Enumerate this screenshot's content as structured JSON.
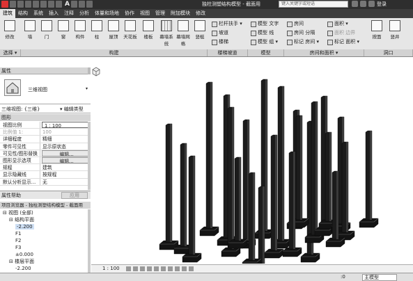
{
  "titlebar": {
    "qat_letter": "A",
    "doc_title": "独柱测塑结构模型 - 截面用",
    "search_placeholder": "键入关键字或短语",
    "login": "登录"
  },
  "tabs": [
    "建筑",
    "结构",
    "系统",
    "插入",
    "注释",
    "分析",
    "体量和场地",
    "协作",
    "视图",
    "管理",
    "附加模块",
    "修改"
  ],
  "ribbon": {
    "modify": "修改",
    "select": "选择 ▾",
    "build_buttons": [
      "墙",
      "门",
      "窗",
      "构件",
      "柱",
      "屋顶",
      "天花板",
      "楼板",
      "幕墙系统",
      "幕墙网格",
      "竖梃"
    ],
    "build_label": "构建",
    "circulation": [
      "栏杆扶手 ▾",
      "坡道",
      "楼梯"
    ],
    "circulation_label": "楼梯坡道",
    "model": [
      "模型 文字",
      "模型 线",
      "模型 组 ▾"
    ],
    "model_label": "模型",
    "room": [
      "房间",
      "房间 分隔",
      "标记 房间 ▾"
    ],
    "area": [
      "面积 ▾",
      "面积 边界",
      "标记 面积 ▾"
    ],
    "room_label": "房间和面积 ▾",
    "opening_buttons": [
      "按面",
      "竖井"
    ],
    "opening_label": "洞口"
  },
  "properties": {
    "header": "属性",
    "type_name": "三维视图",
    "view_select": "三维视图: {三维}",
    "edit_type": "编辑类型",
    "group": "图形",
    "rows": [
      {
        "k": "视图比例",
        "v": "1 : 100"
      },
      {
        "k": "比例值 1:",
        "v": "100"
      },
      {
        "k": "详细程度",
        "v": "精细"
      },
      {
        "k": "零件可见性",
        "v": "显示原状态"
      },
      {
        "k": "可见性/图形替换",
        "v": "编辑..."
      },
      {
        "k": "图形显示选项",
        "v": "编辑..."
      },
      {
        "k": "规程",
        "v": "建筑"
      },
      {
        "k": "显示隐藏线",
        "v": "按规程"
      },
      {
        "k": "默认分析显示...",
        "v": "无"
      }
    ],
    "help": "属性帮助",
    "apply": "应用"
  },
  "browser": {
    "header": "项目浏览器 - 独柱测塑结构模型 - 截面用",
    "nodes": [
      {
        "t": "⊟ 视图 (全部)",
        "lvl": 0
      },
      {
        "t": "⊟ 结构平面",
        "lvl": 1
      },
      {
        "t": "-2.200",
        "lvl": 2,
        "sel": true
      },
      {
        "t": "F1",
        "lvl": 2
      },
      {
        "t": "F2",
        "lvl": 2
      },
      {
        "t": "F3",
        "lvl": 2
      },
      {
        "t": "±0.000",
        "lvl": 2
      },
      {
        "t": "⊟ 楼层平面",
        "lvl": 1
      },
      {
        "t": "-2.200",
        "lvl": 2
      }
    ]
  },
  "status": {
    "scale": "1 : 100",
    "zero": ":0",
    "model": "主模型"
  }
}
